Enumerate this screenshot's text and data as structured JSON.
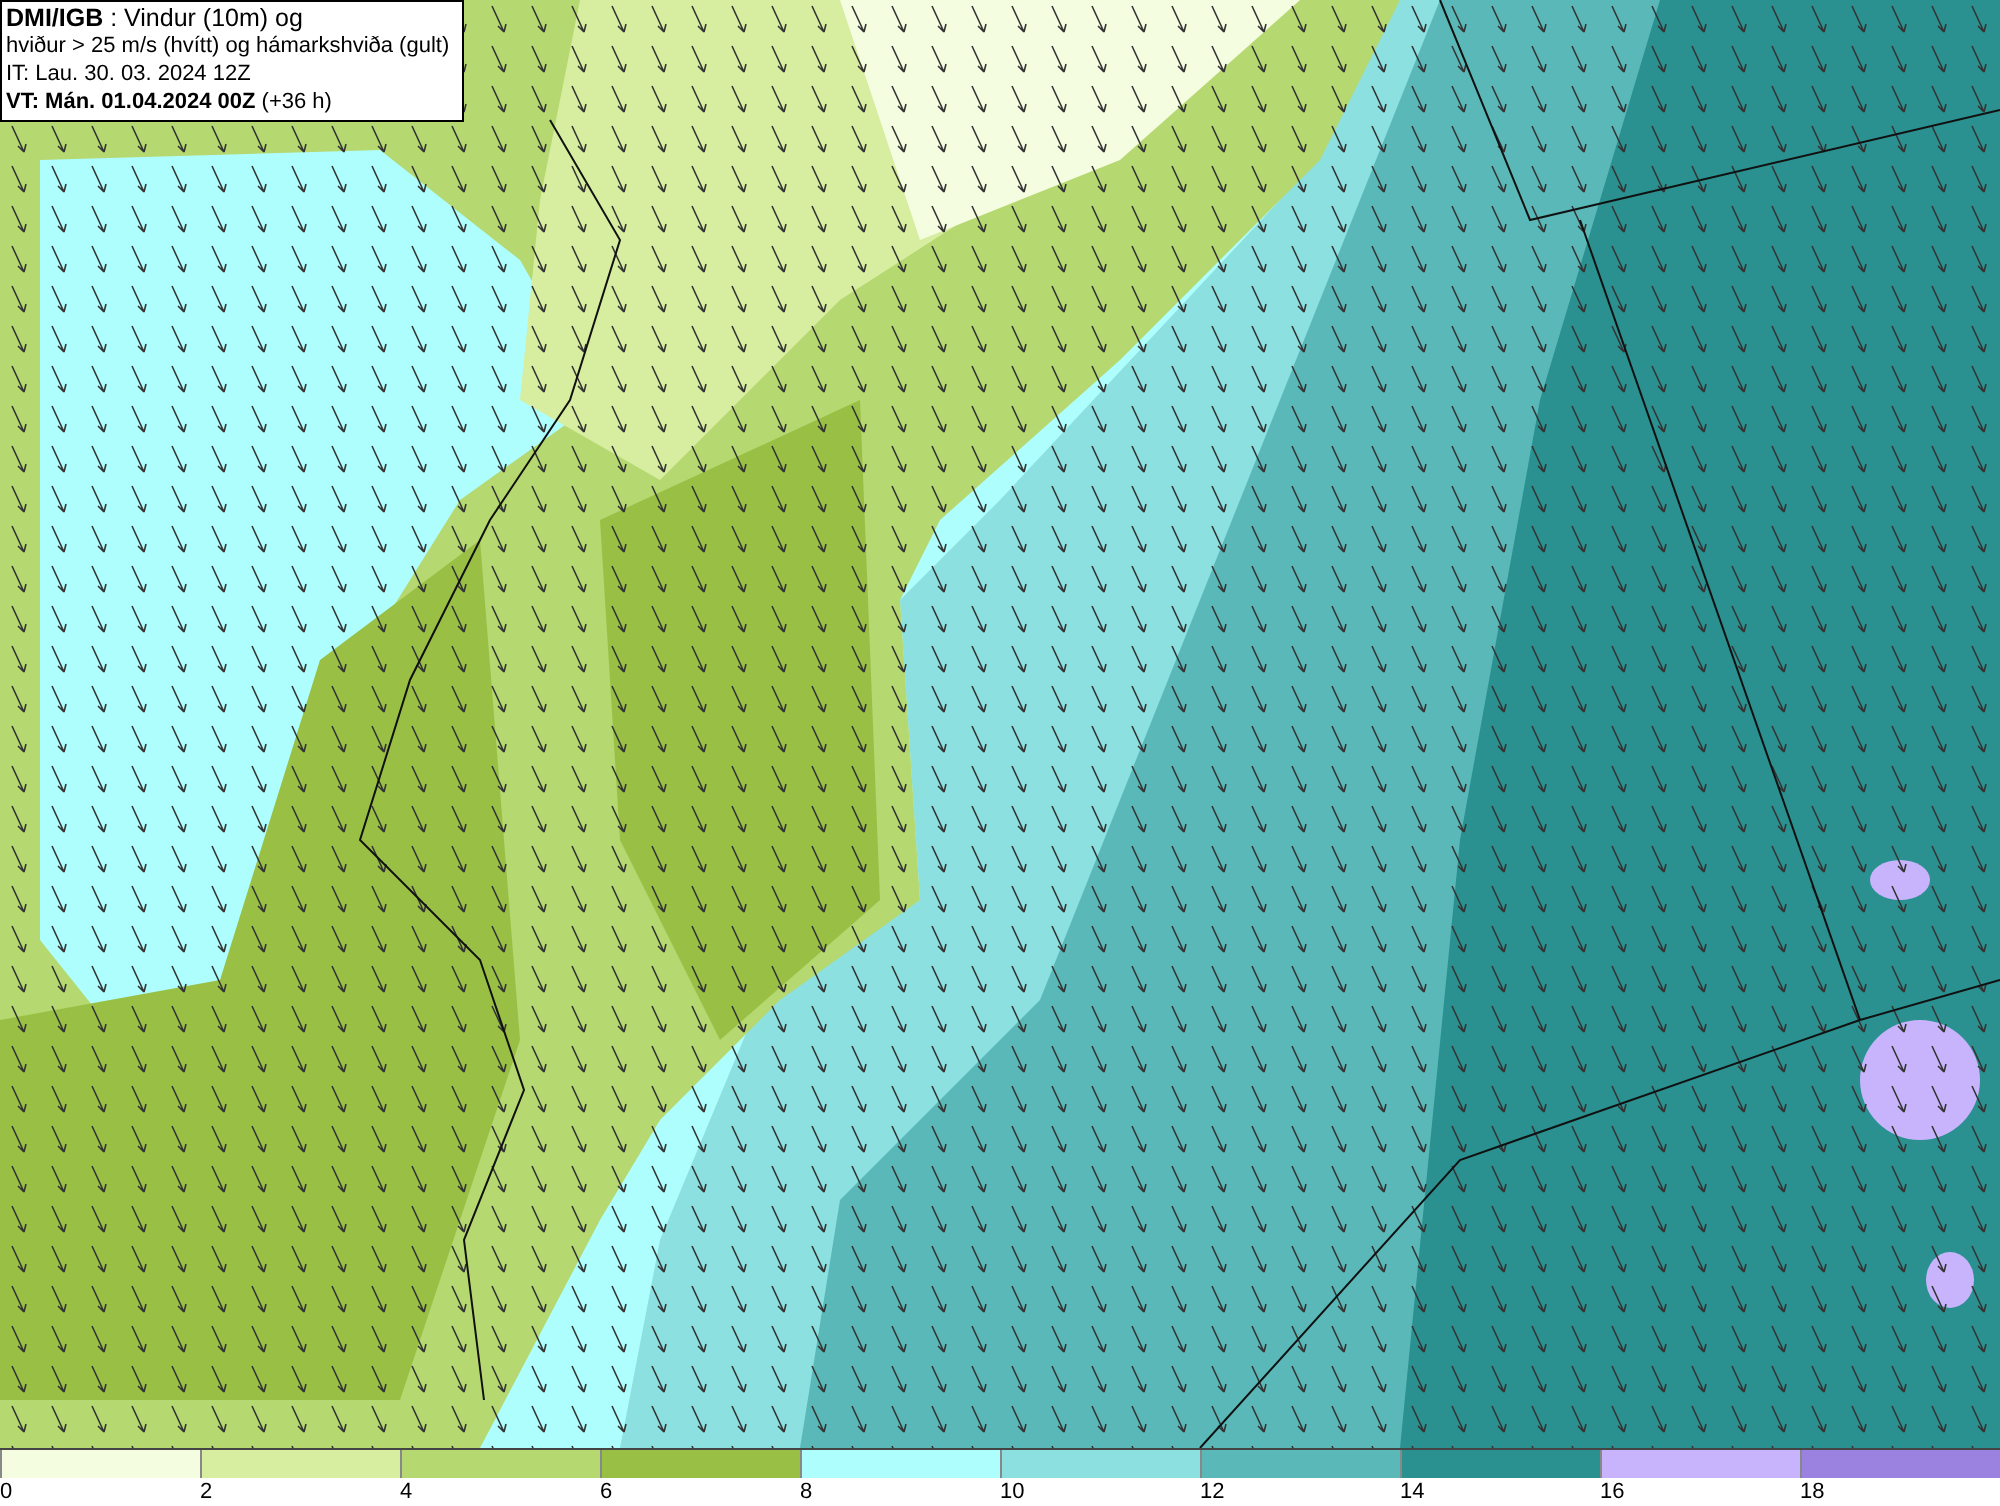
{
  "header": {
    "lines": [
      "**DMI/IGB** : Vindur (10m) og",
      "hviður > 25 m/s (hvítt) og hámarkshviða (gult)",
      "IT: Lau. 30. 03. 2024 12Z",
      "**VT: Mán. 01.04.2024 00Z** (+36 h)"
    ]
  },
  "legend": [
    {
      "label": "0",
      "color": "#f5fde0"
    },
    {
      "label": "2",
      "color": "#d7eea0"
    },
    {
      "label": "4",
      "color": "#b5d870"
    },
    {
      "label": "6",
      "color": "#99c045"
    },
    {
      "label": "8",
      "color": "#aefefe"
    },
    {
      "label": "10",
      "color": "#8ce0e0"
    },
    {
      "label": "12",
      "color": "#5ab8b8"
    },
    {
      "label": "14",
      "color": "#2a9090"
    },
    {
      "label": "16",
      "color": "#c8b4fc"
    },
    {
      "label": "18",
      "color": "#9b82e0"
    }
  ]
}
